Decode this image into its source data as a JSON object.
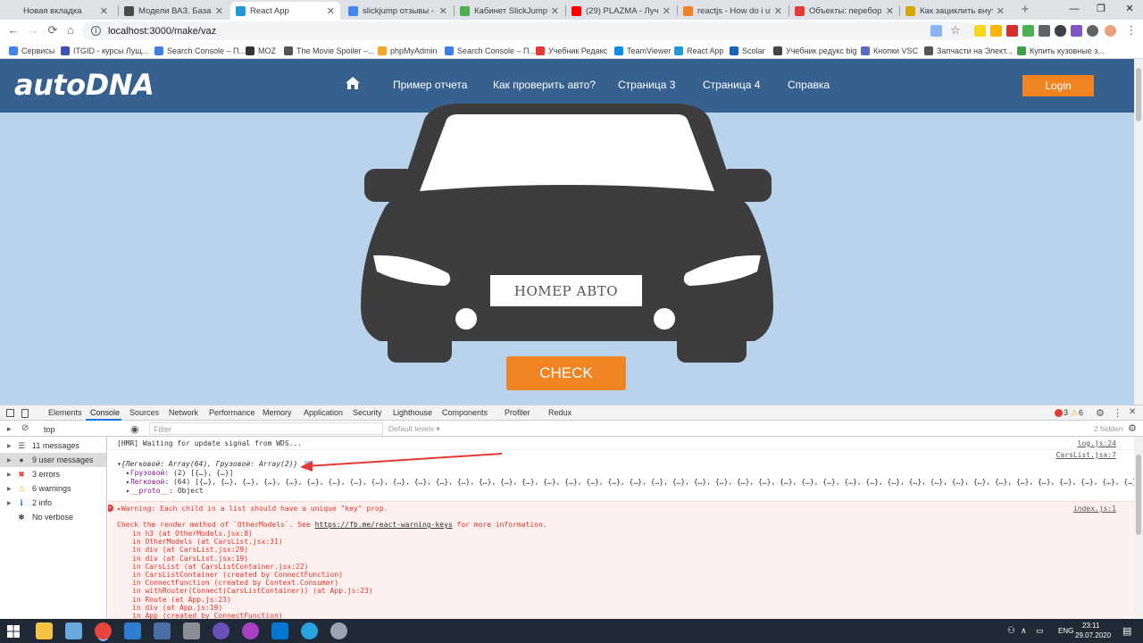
{
  "browser": {
    "tabs": [
      {
        "title": "Новая вкладка",
        "favicon_color": "#dee1e6"
      },
      {
        "title": "Модели ВАЗ. База ГАИ",
        "favicon_color": "#4a4a4a"
      },
      {
        "title": "React App",
        "favicon_color": "#1e9bd7",
        "active": true
      },
      {
        "title": "slickjump отзывы - По",
        "favicon_color": "#4285f4"
      },
      {
        "title": "Кабинет SlickJump",
        "favicon_color": "#4caf50"
      },
      {
        "title": "(29) PLAZMA - Луч",
        "favicon_color": "#ff0000"
      },
      {
        "title": "reactjs - How do i use",
        "favicon_color": "#f48024"
      },
      {
        "title": "Объекты: перебор сво",
        "favicon_color": "#e53935"
      },
      {
        "title": "Как зациклить внутри",
        "favicon_color": "#d8a400"
      }
    ],
    "new_tab": "+",
    "window_controls": {
      "minimize": "—",
      "maximize": "❐",
      "close": "✕"
    },
    "url": "localhost:3000/make/vaz",
    "bookmarks": [
      {
        "label": "Сервисы",
        "color": "#4285f4"
      },
      {
        "label": "ITGID - курсы Лущ...",
        "color": "#3f51b5"
      },
      {
        "label": "Search Console – П...",
        "color": "#3f7ee8"
      },
      {
        "label": "MOZ",
        "color": "#333333"
      },
      {
        "label": "The Movie Spoiler –...",
        "color": "#555555"
      },
      {
        "label": "phpMyAdmin",
        "color": "#f5a623"
      },
      {
        "label": "Search Console – П...",
        "color": "#3f7ee8"
      },
      {
        "label": "Учебник Редакс",
        "color": "#e53935"
      },
      {
        "label": "TeamViewer",
        "color": "#0e8ee9"
      },
      {
        "label": "React App",
        "color": "#1e9bd7"
      },
      {
        "label": "Scolar",
        "color": "#1565c0"
      },
      {
        "label": "Учебник редукс big",
        "color": "#444444"
      },
      {
        "label": "Кнопки VSC",
        "color": "#5c6bc0"
      },
      {
        "label": "Запчасти на Элект...",
        "color": "#555555"
      },
      {
        "label": "Купить кузовные з...",
        "color": "#43a047"
      }
    ]
  },
  "site": {
    "logo": "autoDNA",
    "nav": [
      "Пример отчета",
      "Как проверить авто?",
      "Страница 3",
      "Страница 4",
      "Справка"
    ],
    "login": "Login",
    "plate": "НОМЕР АВТО",
    "check": "CHECK",
    "colors": {
      "header": "#36618f",
      "background": "#b9d3ec",
      "accent": "#f08423",
      "car": "#3d3d3d"
    }
  },
  "devtools": {
    "tabs": [
      "Elements",
      "Console",
      "Sources",
      "Network",
      "Performance",
      "Memory",
      "Application",
      "Security",
      "Lighthouse",
      "Components",
      "Profiler",
      "Redux"
    ],
    "active_tab": "Console",
    "error_count": "3",
    "warning_count": "6",
    "context": "top",
    "filter_placeholder": "Filter",
    "levels": "Default levels ▾",
    "hidden": "2 hidden",
    "sidebar": [
      {
        "label": "11 messages",
        "icon": "list-icon"
      },
      {
        "label": "9 user messages",
        "icon": "user-icon",
        "selected": true
      },
      {
        "label": "3 errors",
        "icon": "error-icon"
      },
      {
        "label": "6 warnings",
        "icon": "warning-icon"
      },
      {
        "label": "2 info",
        "icon": "info-icon"
      },
      {
        "label": "No verbose",
        "icon": "verbose-icon"
      }
    ],
    "lines": {
      "hmr": "[HMR] Waiting for update signal from WDS...",
      "hmr_src": "log.js:24",
      "obj_src": "CarsList.jsx:7",
      "obj_head": "▾{Легковой: Array(64), Грузовой: Array(2)}",
      "obj_l1_key": "Грузовой",
      "obj_l1_val": ": (2) [{…}, {…}]",
      "obj_l2_key": "Легковой",
      "obj_l2_val": ": (64) [{…}, {…}, {…}, {…}, {…}, {…}, {…}, {…}, {…}, {…}, {…}, {…}, {…}, {…}, {…}, {…}, {…}, {…}, {…}, {…}, {…}, {…}, {…}, {…}, {…}, {…}, {…}, {…}, {…}, {…}, {…}, {…}, {…}, {…}, {…}, {…}, {…}, {…}, {…}, {…}, {…}, {…}, {…}, {…}, {…}, {…}, {…}, {…}, {…}, {…}, {…},…",
      "obj_l3_key": "__proto__",
      "obj_l3_val": ": Object",
      "warn": "Warning: Each child in a list should have a unique \"key\" prop.",
      "warn_src": "index.js:1",
      "check_render_a": "Check the render method of `OtherModels`. See ",
      "check_render_link": "https://fb.me/react-warning-keys",
      "check_render_b": " for more information.",
      "stack": [
        "in h3 (at OtherModels.jsx:8)",
        "in OtherModels (at CarsList.jsx:31)",
        "in div (at CarsList.jsx:29)",
        "in div (at CarsList.jsx:19)",
        "in CarsList (at CarsListContainer.jsx:22)",
        "in CarsListContainer (created by ConnectFunction)",
        "in ConnectFunction (created by Context.Consumer)",
        "in withRouter(Connect(CarsListContainer)) (at App.js:23)",
        "in Route (at App.js:23)",
        "in div (at App.js:19)",
        "in App (created by ConnectFunction)"
      ]
    }
  },
  "taskbar": {
    "language": "ENG",
    "time": "23:11",
    "date": "29.07.2020"
  }
}
